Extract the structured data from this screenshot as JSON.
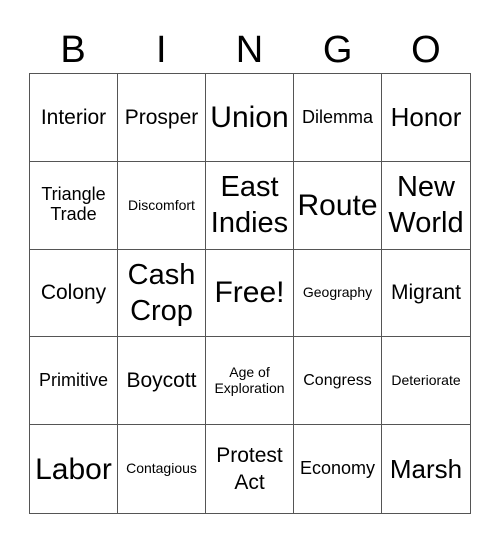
{
  "header": [
    "B",
    "I",
    "N",
    "G",
    "O"
  ],
  "cells": [
    [
      "Interior",
      "Prosper",
      "Union",
      "Dilemma",
      "Honor"
    ],
    [
      "Triangle Trade",
      "Discomfort",
      "East Indies",
      "Route",
      "New World"
    ],
    [
      "Colony",
      "Cash Crop",
      "Free!",
      "Geography",
      "Migrant"
    ],
    [
      "Primitive",
      "Boycott",
      "Age of Exploration",
      "Congress",
      "Deteriorate"
    ],
    [
      "Labor",
      "Contagious",
      "Protest Act",
      "Economy",
      "Marsh"
    ]
  ]
}
